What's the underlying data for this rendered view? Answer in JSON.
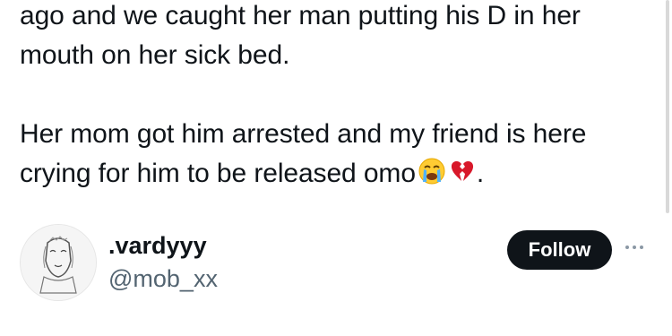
{
  "tweet": {
    "lines_1": [
      "ago and we caught her man putting his D in her",
      "mouth on her sick bed."
    ],
    "line_2a": "Her mom got him arrested and my friend is here",
    "line_2b_text": "crying for him to be released omo",
    "line_2b_end": ".",
    "emojis": [
      "crying-face-icon",
      "broken-heart-icon"
    ]
  },
  "author": {
    "display_name": ".vardyyy",
    "handle": "@mob_xx",
    "avatar_icon": "avatar-sketch-icon"
  },
  "actions": {
    "follow_label": "Follow",
    "more_icon": "more-dots-icon"
  },
  "colors": {
    "text": "#0f1419",
    "secondary": "#536471",
    "button_bg": "#0f1419",
    "button_text": "#ffffff"
  }
}
